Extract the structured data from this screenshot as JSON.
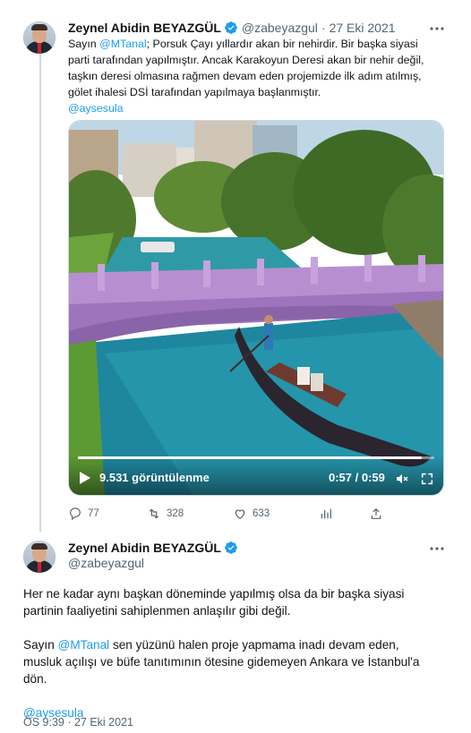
{
  "colors": {
    "accent": "#1d9bf0",
    "muted": "#536471",
    "text": "#0f1419",
    "line": "#cfd9de"
  },
  "tweet1": {
    "name": "Zeynel Abidin BEYAZGÜL",
    "handle": "@zabeyazgul",
    "separator": "·",
    "date": "27 Eki 2021",
    "more_icon": "more-icon",
    "text_line1_pre": "Sayın ",
    "text_line1_mention": "@MTanal",
    "text_line1_post": "; Porsuk Çayı yıllardır akan bir nehirdir. Bir başka siyasi",
    "text_line2": "parti tarafından yapılmıştır. Ancak Karakoyun Deresi akan bir nehir değil,",
    "text_line3": "taşkın deresi olmasına rağmen devam eden projemizde ilk adım atılmış,",
    "text_line4": "gölet ihalesi DSİ tarafından yapılmaya başlanmıştır.",
    "tag": "@aysesula",
    "video": {
      "views": "9.531 görüntülenme",
      "time": "0:57 / 0:59",
      "progress": 0.966
    },
    "actions": {
      "reply_count": "77",
      "retweet_count": "328",
      "like_count": "633"
    }
  },
  "tweet2": {
    "name": "Zeynel Abidin BEYAZGÜL",
    "handle": "@zabeyazgul",
    "para1_line1": "Her ne kadar aynı başkan döneminde yapılmış olsa da bir başka siyasi",
    "para1_line2": "partinin faaliyetini sahiplenmen anlaşılır gibi değil.",
    "para2_line1_pre": "Sayın ",
    "para2_line1_mention": "@MTanal",
    "para2_line1_post": " sen yüzünü halen proje yapmama inadı devam eden,",
    "para2_line2": "musluk açılışı ve büfe tanıtımının ötesine gidemeyen Ankara ve İstanbul'a",
    "para2_line3": "dön.",
    "tag": "@aysesula",
    "timestamp": "ÖS 9:39 · 27 Eki 2021"
  }
}
